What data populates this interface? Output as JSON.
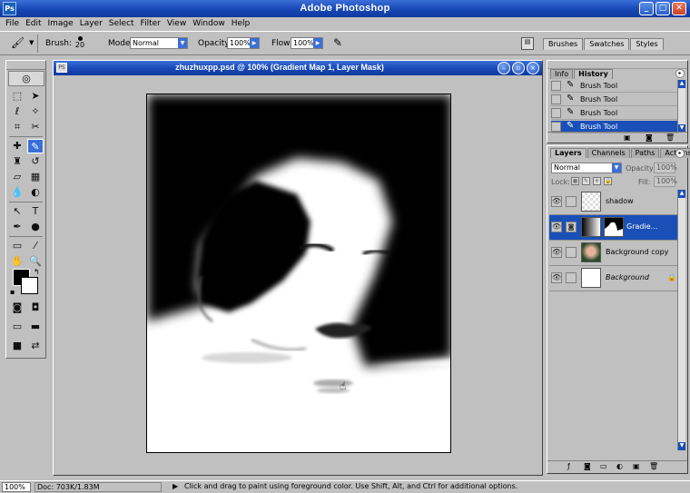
{
  "app": {
    "title": "Adobe Photoshop",
    "icon_label": "Ps"
  },
  "window_buttons": [
    "_",
    "▢",
    "✕"
  ],
  "menu": [
    "File",
    "Edit",
    "Image",
    "Layer",
    "Select",
    "Filter",
    "View",
    "Window",
    "Help"
  ],
  "options": {
    "brush_label": "Brush:",
    "brush_size": "20",
    "mode_label": "Mode:",
    "mode_value": "Normal",
    "opacity_label": "Opacity:",
    "opacity_value": "100%",
    "flow_label": "Flow:",
    "flow_value": "100%",
    "well_tabs": [
      "Brushes",
      "Swatches",
      "Styles"
    ]
  },
  "document": {
    "title": "zhuzhuxpp.psd @ 100% (Gradient Map 1, Layer Mask)",
    "icon_label": "PS"
  },
  "history": {
    "tabs": [
      "Info",
      "History"
    ],
    "items": [
      {
        "label": "Brush Tool",
        "selected": false
      },
      {
        "label": "Brush Tool",
        "selected": false
      },
      {
        "label": "Brush Tool",
        "selected": false
      },
      {
        "label": "Brush Tool",
        "selected": true
      }
    ]
  },
  "layers": {
    "tabs": [
      "Layers",
      "Channels",
      "Paths",
      "Actions"
    ],
    "blend_mode": "Normal",
    "opacity_label": "Opacity:",
    "opacity_value": "100%",
    "lock_label": "Lock:",
    "fill_label": "Fill:",
    "fill_value": "100%",
    "items": [
      {
        "name": "shadow",
        "selected": false
      },
      {
        "name": "Gradie...",
        "selected": true
      },
      {
        "name": "Background copy",
        "selected": false
      },
      {
        "name": "Background",
        "selected": false
      }
    ]
  },
  "status": {
    "zoom": "100%",
    "doc_info": "Doc: 703K/1.83M",
    "hint": "Click and drag to paint using foreground color. Use Shift, Alt, and Ctrl for additional options."
  },
  "colors": {
    "accent": "#1a4fb8",
    "title_bar": "#1747b5",
    "chrome": "#c0c0c0"
  }
}
